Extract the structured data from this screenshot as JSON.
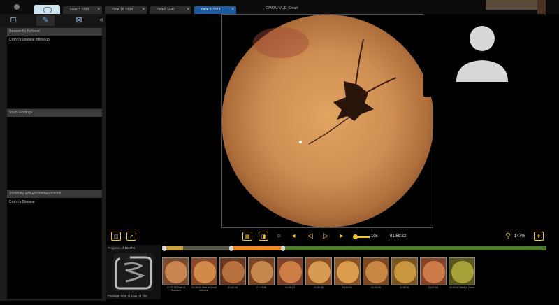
{
  "app_title": "OMOM VUE Smart",
  "tabs": [
    {
      "label": "case 7 3235",
      "active": false
    },
    {
      "label": "case 16 3334",
      "active": false
    },
    {
      "label": "case2 3240",
      "active": false
    },
    {
      "label": "case 5 3323",
      "active": true
    }
  ],
  "left_panel": {
    "icons": [
      "capture-icon",
      "edit-icon",
      "report-icon"
    ],
    "sections": [
      {
        "title": "Reason for Referral",
        "text": "Crohn's Disease follow up"
      },
      {
        "title": "Study Findings",
        "text": ""
      },
      {
        "title": "Summary and Recommendations",
        "text": "Crohn's Disease"
      }
    ]
  },
  "controls": {
    "speed": "10x",
    "time": "01:59:22",
    "zoom": "147%"
  },
  "progress": {
    "title": "Progress of 1BUTN",
    "footer": "Passage time of 1BUTN film"
  },
  "thumbnails": [
    {
      "caption": "01:02:35\nStart of Stomach"
    },
    {
      "caption": "01:38:02\nStart of Small intestine"
    },
    {
      "caption": "01:42:16"
    },
    {
      "caption": "01:43:48"
    },
    {
      "caption": "01:45:12"
    },
    {
      "caption": "01:50:26"
    },
    {
      "caption": "01:52:04"
    },
    {
      "caption": "01:53:40"
    },
    {
      "caption": "01:55:31"
    },
    {
      "caption": "01:57:08"
    },
    {
      "caption": "02:03:46\nStart of Colon"
    }
  ],
  "colors": {
    "accent": "#f4c430",
    "active_tab": "#1e5aa0",
    "progress": "#f08a24"
  }
}
